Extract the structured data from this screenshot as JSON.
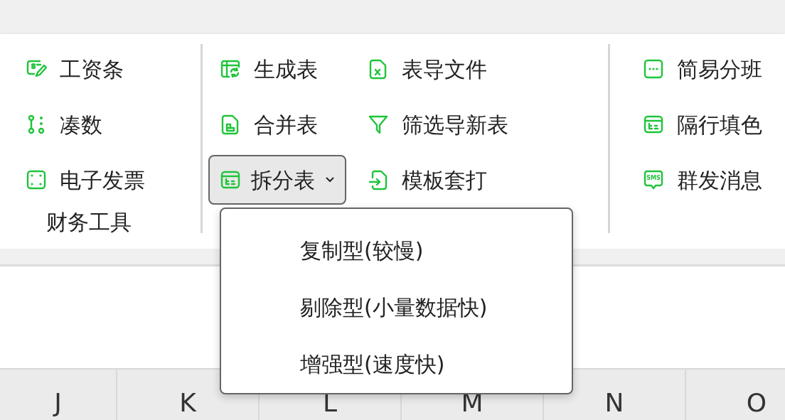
{
  "ribbon": {
    "groups": [
      {
        "label": "财务工具",
        "columns": [
          [
            {
              "label": "工资条"
            },
            {
              "label": "凑数"
            },
            {
              "label": "电子发票"
            }
          ]
        ]
      },
      {
        "columns": [
          [
            {
              "label": "生成表"
            },
            {
              "label": "合并表"
            },
            {
              "label": "拆分表",
              "kind": "split",
              "expanded": true
            }
          ],
          [
            {
              "label": "表导文件"
            },
            {
              "label": "筛选导新表"
            },
            {
              "label": "模板套打"
            }
          ]
        ]
      },
      {
        "columns": [
          [
            {
              "label": "简易分班"
            },
            {
              "label": "隔行填色"
            },
            {
              "label": "群发消息",
              "icon_text": "SMS"
            }
          ]
        ]
      }
    ]
  },
  "dropdown_menu": {
    "items": [
      {
        "label": "复制型(较慢)"
      },
      {
        "label": "剔除型(小量数据快)"
      },
      {
        "label": "增强型(速度快)"
      }
    ]
  },
  "column_headers": [
    "J",
    "K",
    "L",
    "M",
    "N",
    "O"
  ]
}
